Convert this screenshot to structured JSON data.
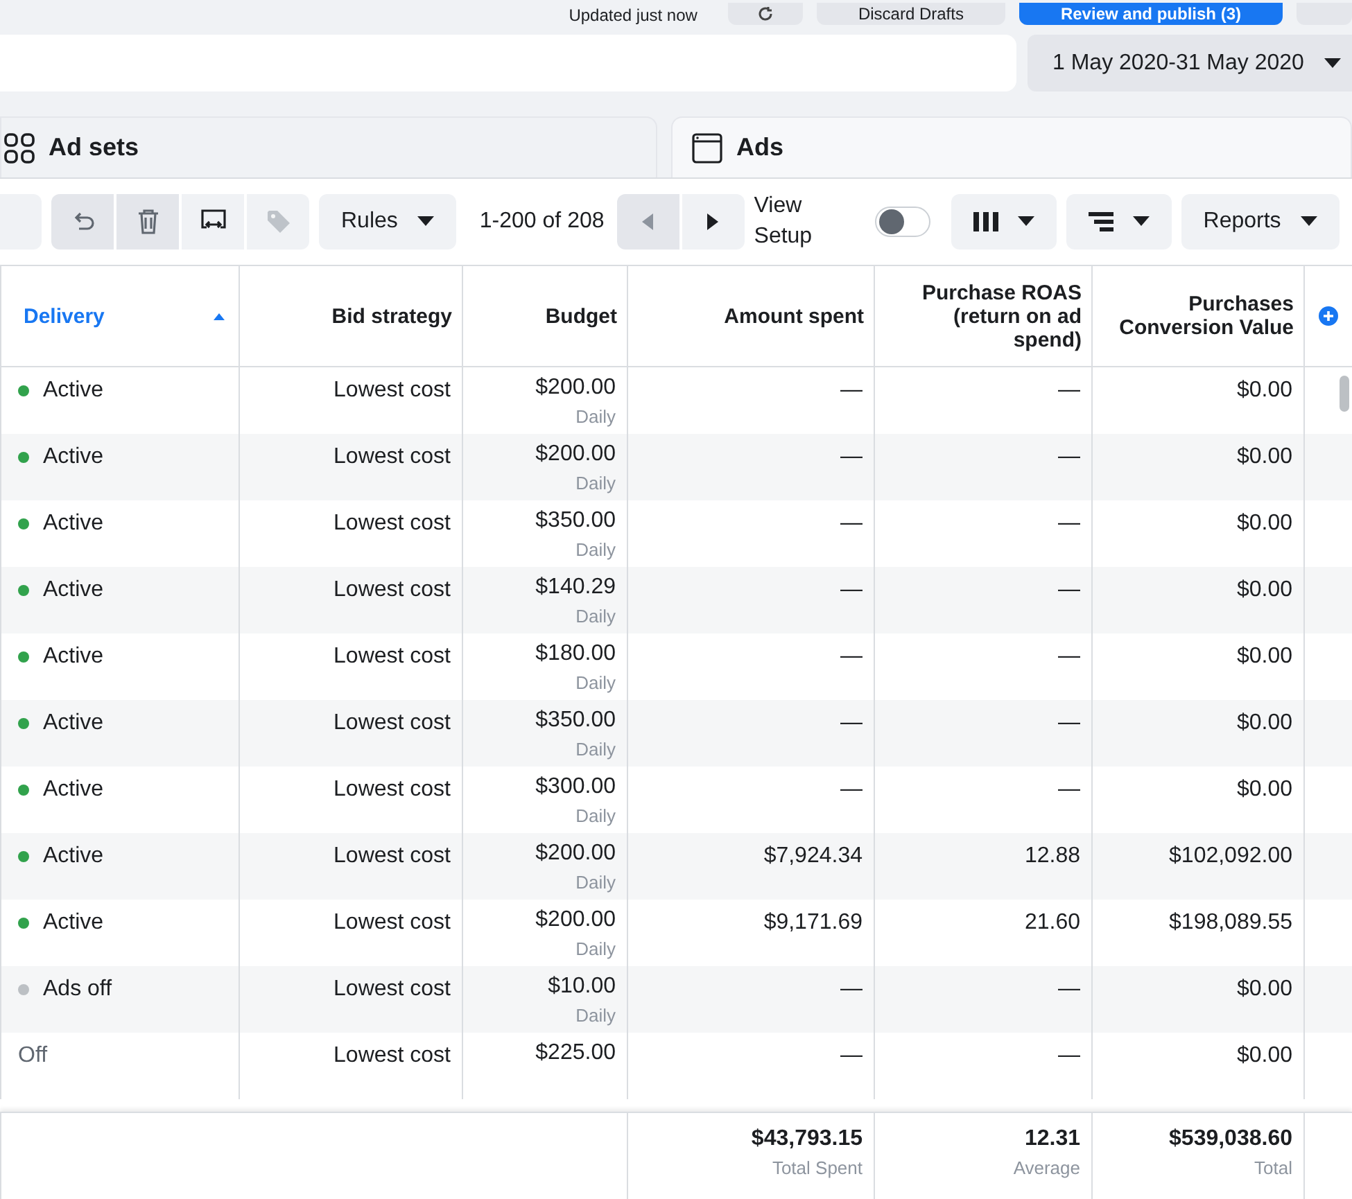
{
  "top_bar": {
    "status": "Updated just now",
    "discard_button": "Discard Drafts",
    "publish_button": "Review and publish (3)"
  },
  "date_range": {
    "value": "1 May 2020-31 May 2020"
  },
  "tabs": [
    {
      "label": "Ad sets"
    },
    {
      "label": "Ads"
    }
  ],
  "toolbar": {
    "rules_button": "Rules",
    "page_range": "1-200 of 208",
    "prev_disabled": true,
    "view_setup_label": "View Setup",
    "view_setup_on": false,
    "reports_button": "Reports"
  },
  "table": {
    "columns": [
      {
        "label": "Delivery",
        "sorted": true
      },
      {
        "label": "Bid strategy",
        "sorted": false
      },
      {
        "label": "Budget",
        "sorted": false
      },
      {
        "label": "Amount spent",
        "sorted": false
      },
      {
        "label": "Purchase ROAS (return on ad spend)",
        "sorted": false
      },
      {
        "label": "Purchases Conversion Value",
        "sorted": false
      }
    ],
    "rows": [
      {
        "delivery": "Active",
        "kind": "active",
        "color": "#31a24c",
        "bid": "Lowest cost",
        "budget": "$200.00",
        "period": "Daily",
        "spent": "—",
        "roas": "—",
        "value": "$0.00"
      },
      {
        "delivery": "Active",
        "kind": "active",
        "color": "#31a24c",
        "bid": "Lowest cost",
        "budget": "$200.00",
        "period": "Daily",
        "spent": "—",
        "roas": "—",
        "value": "$0.00"
      },
      {
        "delivery": "Active",
        "kind": "active",
        "color": "#31a24c",
        "bid": "Lowest cost",
        "budget": "$350.00",
        "period": "Daily",
        "spent": "—",
        "roas": "—",
        "value": "$0.00"
      },
      {
        "delivery": "Active",
        "kind": "active",
        "color": "#31a24c",
        "bid": "Lowest cost",
        "budget": "$140.29",
        "period": "Daily",
        "spent": "—",
        "roas": "—",
        "value": "$0.00"
      },
      {
        "delivery": "Active",
        "kind": "active",
        "color": "#31a24c",
        "bid": "Lowest cost",
        "budget": "$180.00",
        "period": "Daily",
        "spent": "—",
        "roas": "—",
        "value": "$0.00"
      },
      {
        "delivery": "Active",
        "kind": "active",
        "color": "#31a24c",
        "bid": "Lowest cost",
        "budget": "$350.00",
        "period": "Daily",
        "spent": "—",
        "roas": "—",
        "value": "$0.00"
      },
      {
        "delivery": "Active",
        "kind": "active",
        "color": "#31a24c",
        "bid": "Lowest cost",
        "budget": "$300.00",
        "period": "Daily",
        "spent": "—",
        "roas": "—",
        "value": "$0.00"
      },
      {
        "delivery": "Active",
        "kind": "active",
        "color": "#31a24c",
        "bid": "Lowest cost",
        "budget": "$200.00",
        "period": "Daily",
        "spent": "$7,924.34",
        "roas": "12.88",
        "value": "$102,092.00"
      },
      {
        "delivery": "Active",
        "kind": "active",
        "color": "#31a24c",
        "bid": "Lowest cost",
        "budget": "$200.00",
        "period": "Daily",
        "spent": "$9,171.69",
        "roas": "21.60",
        "value": "$198,089.55"
      },
      {
        "delivery": "Ads off",
        "kind": "inactive",
        "color": "#bcc0c4",
        "bid": "Lowest cost",
        "budget": "$10.00",
        "period": "Daily",
        "spent": "—",
        "roas": "—",
        "value": "$0.00"
      },
      {
        "delivery": "Off",
        "kind": "off",
        "bid": "Lowest cost",
        "budget": "$225.00",
        "spent": "—",
        "roas": "—",
        "value": "$0.00"
      }
    ],
    "totals": {
      "spent": "$43,793.15",
      "spent_label": "Total Spent",
      "roas": "12.31",
      "roas_label": "Average",
      "value": "$539,038.60",
      "value_label": "Total"
    }
  }
}
